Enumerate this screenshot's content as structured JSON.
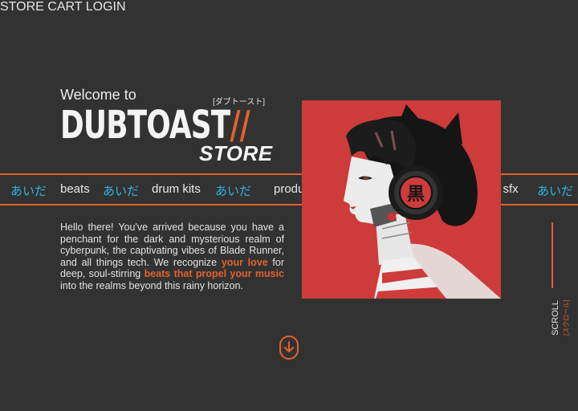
{
  "nav": {
    "store": "STORE",
    "cart": "CART",
    "login": "LOGIN"
  },
  "hero": {
    "welcome": "Welcome to",
    "kana_tag": "[ダブトースト]",
    "brand": "DUBTOAST",
    "brand_slashes": "//",
    "store": "STORE"
  },
  "ticker": {
    "items": [
      "あいだ",
      "beats",
      "あいだ",
      "drum kits",
      "あいだ",
      "produ",
      "d sfx",
      "あいだ"
    ]
  },
  "intro": {
    "part1": "Hello there! You've arrived because you have a penchant for the dark and mysterious realm of cyberpunk, the captivating vibes of Blade Runner, and all things tech. We recognize ",
    "highlight1": "your love",
    "part2": " for deep, soul-stirring ",
    "highlight2": "beats that propel your music",
    "part3": " into the realms beyond this rainy horizon."
  },
  "artwork": {
    "kanji": "黒"
  },
  "scroll": {
    "label": "SCROLL",
    "kana": "[スクロール]"
  },
  "icons": {
    "down": "arrow-down-circle-icon"
  },
  "colors": {
    "background": "#333232",
    "accent": "#e0622f",
    "kana": "#2db6e4",
    "art_bg": "#cd3b3b"
  }
}
